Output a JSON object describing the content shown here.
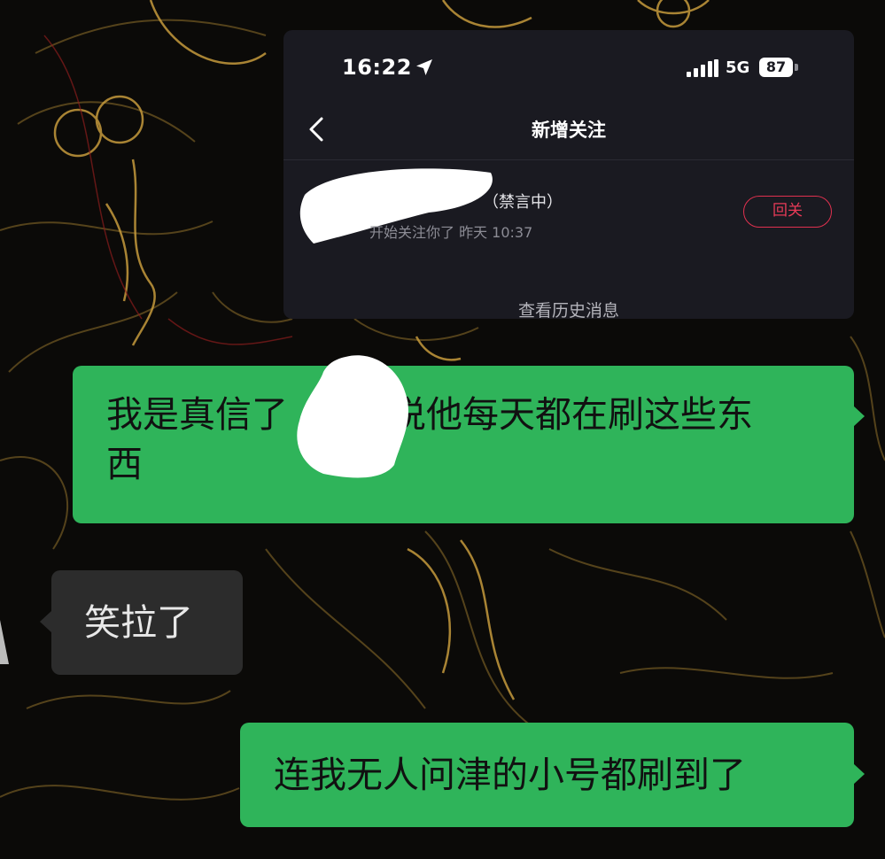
{
  "background": {
    "description_color": "#0b0a08",
    "accent": "#b8913a"
  },
  "screenshot": {
    "status_bar": {
      "time": "16:22",
      "network": "5G",
      "battery": "87",
      "location_icon": "location-arrow-icon",
      "signal_icon": "cellular-signal-icon"
    },
    "nav": {
      "back_icon": "chevron-left-icon",
      "title": "新增关注"
    },
    "notification": {
      "user_status": "（禁言中）",
      "action_text": "开始关注你了 昨天 10:37",
      "follow_back_label": "回关",
      "follow_back_color": "#e0314f"
    },
    "history_link": "查看历史消息"
  },
  "chat": {
    "messages": [
      {
        "side": "right",
        "text_before": "我是真信了",
        "text_after": "说他每天都在刷这些东",
        "text_line2": "西"
      },
      {
        "side": "left",
        "text": "笑拉了"
      },
      {
        "side": "right",
        "text": "连我无人问津的小号都刷到了"
      }
    ],
    "colors": {
      "outgoing": "#2fb45a",
      "incoming": "#2c2c2c"
    }
  }
}
